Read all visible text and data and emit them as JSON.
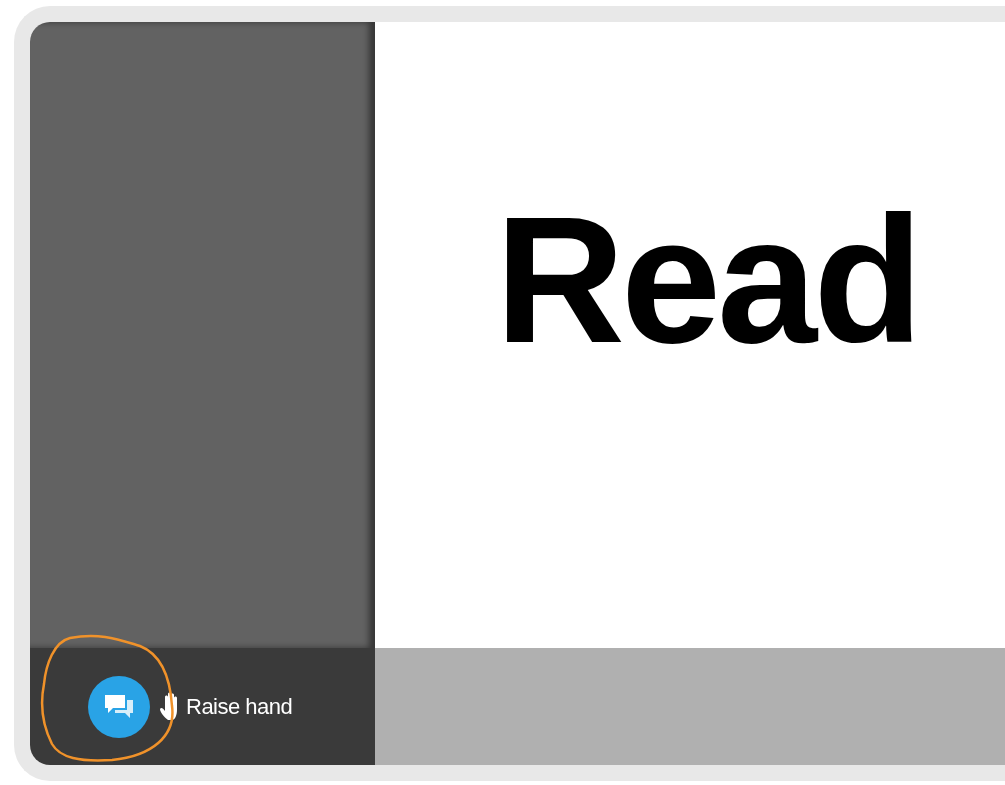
{
  "slide": {
    "title": "Read"
  },
  "toolbar": {
    "raise_hand_label": "Raise hand"
  }
}
